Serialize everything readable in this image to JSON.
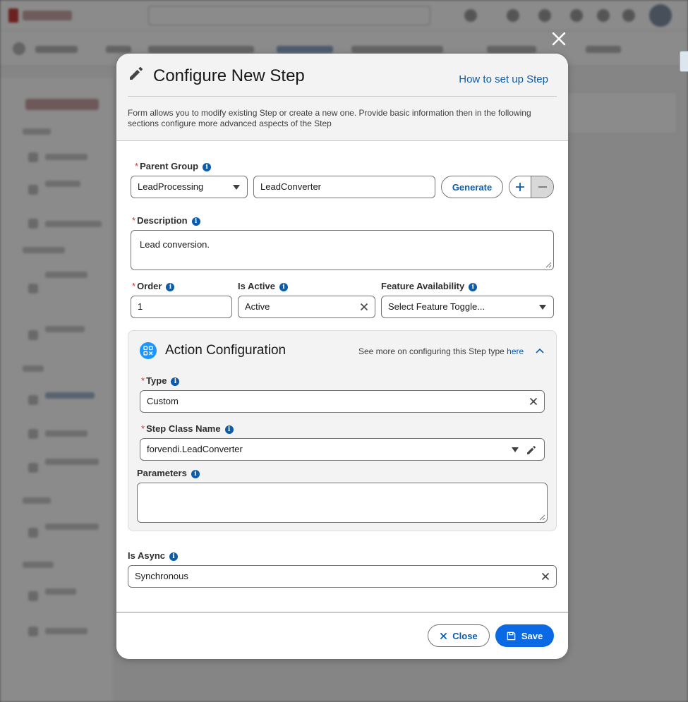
{
  "modal": {
    "title": "Configure New Step",
    "help_link": "How to set up Step",
    "description": "Form allows you to modify existing Step or create a new one. Provide basic information then in the following sections configure more advanced aspects of the Step",
    "info_glyph": "i",
    "required_mark": "*"
  },
  "parent_group": {
    "label": "Parent Group",
    "selected": "LeadProcessing",
    "name_value": "LeadConverter",
    "generate_label": "Generate"
  },
  "description_field": {
    "label": "Description",
    "value": "Lead conversion."
  },
  "order": {
    "label": "Order",
    "value": "1"
  },
  "is_active": {
    "label": "Is Active",
    "value": "Active"
  },
  "feature_availability": {
    "label": "Feature Availability",
    "placeholder": "Select Feature Toggle..."
  },
  "action_config": {
    "title": "Action Configuration",
    "hint_text": "See more on configuring this Step type",
    "hint_link": "here",
    "type_label": "Type",
    "type_value": "Custom",
    "class_label": "Step Class Name",
    "class_value": "forvendi.LeadConverter",
    "params_label": "Parameters",
    "params_value": ""
  },
  "is_async": {
    "label": "Is Async",
    "value": "Synchronous"
  },
  "footer": {
    "close_label": "Close",
    "save_label": "Save"
  },
  "colors": {
    "brand": "#0b5cab",
    "save_button": "#0b6ae3",
    "required": "#c23934",
    "action_icon": "#1b96ff"
  },
  "icons": [
    "close-icon",
    "pencil-icon",
    "info-icon",
    "chevron-down-icon",
    "plus-icon",
    "minus-icon",
    "action-config-icon",
    "chevron-up-icon",
    "edit-icon",
    "save-icon"
  ]
}
